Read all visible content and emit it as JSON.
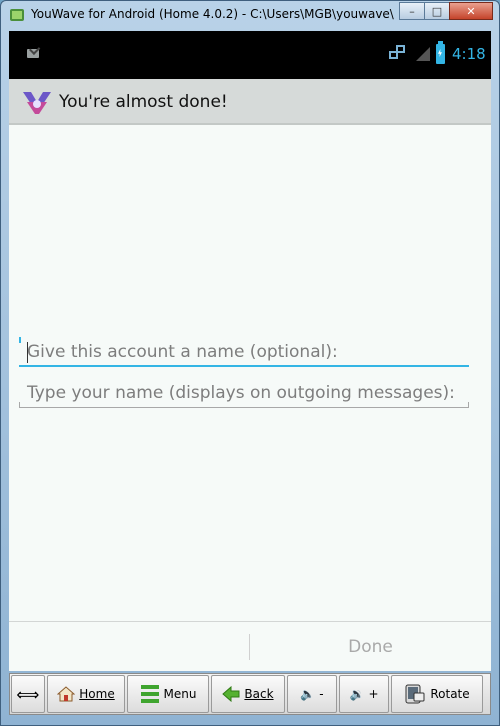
{
  "window": {
    "title": "YouWave for Android (Home 4.0.2) - C:\\Users\\MGB\\youwave\\",
    "minimize_icon": "minimize-icon",
    "maximize_icon": "maximize-icon",
    "close_icon": "close-icon"
  },
  "statusbar": {
    "time": "4:18",
    "icons": [
      "mail-icon",
      "network-icon",
      "signal-icon",
      "battery-charging-icon"
    ]
  },
  "actionbar": {
    "title": "You're almost done!"
  },
  "form": {
    "account_name_placeholder": "Give this account a name (optional):",
    "your_name_placeholder": "Type your name (displays on outgoing messages):"
  },
  "bottom_bar": {
    "done_label": "Done"
  },
  "toolbar": {
    "home_label": "Home",
    "menu_label": "Menu",
    "back_label": "Back",
    "vol_down_label": "-",
    "vol_up_label": "+",
    "rotate_label": "Rotate"
  },
  "colors": {
    "accent": "#33b5e5",
    "hint_text": "#7d7d7d",
    "done_disabled": "#a9a9a9"
  }
}
